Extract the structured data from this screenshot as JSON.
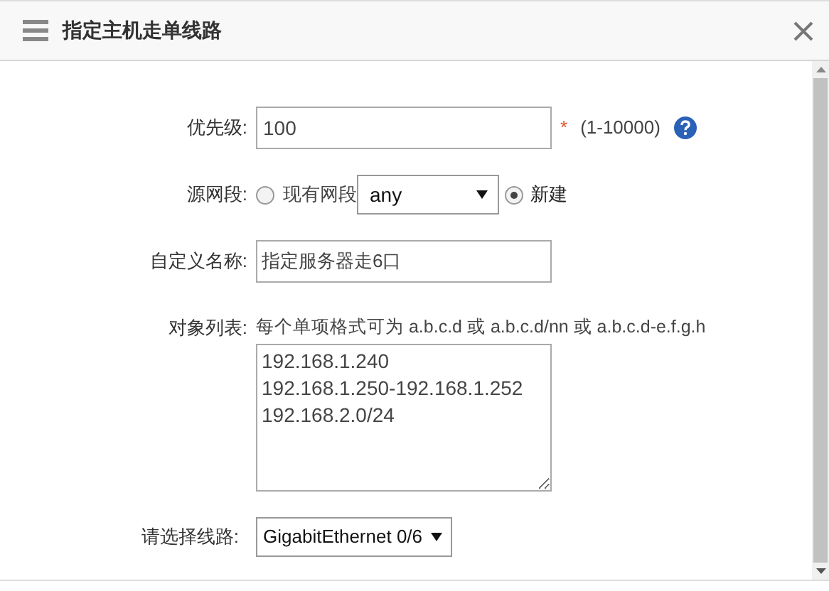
{
  "dialog": {
    "title": "指定主机走单线路"
  },
  "priority": {
    "label": "优先级:",
    "value": "100",
    "required_mark": "*",
    "range": "(1-10000)"
  },
  "source": {
    "label": "源网段:",
    "options": [
      {
        "label": "现有网段",
        "selected": false
      },
      {
        "label": "新建",
        "selected": true
      }
    ],
    "select_value": "any"
  },
  "custom_name": {
    "label": "自定义名称:",
    "value": "指定服务器走6口"
  },
  "object_list": {
    "label": "对象列表:",
    "hint": "每个单项格式可为 a.b.c.d 或 a.b.c.d/nn 或 a.b.c.d-e.f.g.h",
    "lines": [
      "192.168.1.240",
      "192.168.1.250-192.168.1.252",
      "192.168.2.0/24"
    ]
  },
  "line": {
    "label": "请选择线路:",
    "value": "GigabitEthernet 0/6"
  }
}
